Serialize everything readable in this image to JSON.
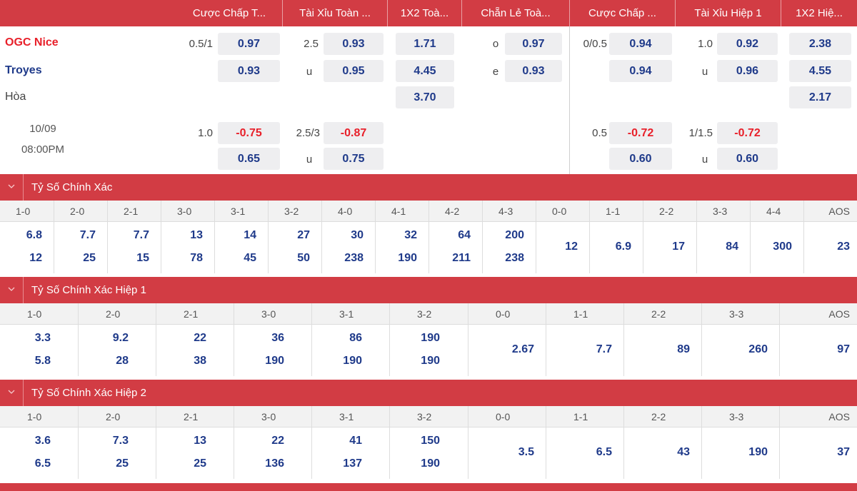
{
  "header": {
    "columns": [
      "Cược Chấp T...",
      "Tài Xỉu Toàn ...",
      "1X2 Toà...",
      "Chẵn Lẻ Toà...",
      "Cược Chấp ...",
      "Tài Xỉu Hiệp 1",
      "1X2 Hiệ..."
    ]
  },
  "match": {
    "home_team": "OGC Nice",
    "away_team": "Troyes",
    "draw_label": "Hòa",
    "date": "10/09",
    "time": "08:00PM"
  },
  "odds": {
    "ft_handicap": {
      "line": "0.5/1",
      "home": "0.97",
      "away": "0.93"
    },
    "ft_total": {
      "line": "2.5",
      "over": "0.93",
      "under_label": "u",
      "under": "0.95"
    },
    "ft_1x2": {
      "home": "1.71",
      "away": "4.45",
      "draw": "3.70"
    },
    "ft_odd_even": {
      "odd_label": "o",
      "odd": "0.97",
      "even_label": "e",
      "even": "0.93"
    },
    "h1_handicap": {
      "line": "0/0.5",
      "home": "0.94",
      "away": "0.94"
    },
    "h1_total": {
      "line": "1.0",
      "over": "0.92",
      "under_label": "u",
      "under": "0.96"
    },
    "h1_1x2": {
      "home": "2.38",
      "away": "4.55",
      "draw": "2.17"
    },
    "alt": {
      "ft_handicap": {
        "line": "1.0",
        "home": "-0.75",
        "away": "0.65"
      },
      "ft_total": {
        "line": "2.5/3",
        "over": "-0.87",
        "under_label": "u",
        "under": "0.75"
      },
      "h1_handicap": {
        "line": "0.5",
        "home": "-0.72",
        "away": "0.60"
      },
      "h1_total": {
        "line": "1/1.5",
        "over": "-0.72",
        "under_label": "u",
        "under": "0.60"
      }
    }
  },
  "sections": [
    {
      "title": "Tỷ Số Chính Xác",
      "scores": [
        {
          "label": "1-0",
          "home": "6.8",
          "away": "12"
        },
        {
          "label": "2-0",
          "home": "7.7",
          "away": "25"
        },
        {
          "label": "2-1",
          "home": "7.7",
          "away": "15"
        },
        {
          "label": "3-0",
          "home": "13",
          "away": "78"
        },
        {
          "label": "3-1",
          "home": "14",
          "away": "45"
        },
        {
          "label": "3-2",
          "home": "27",
          "away": "50"
        },
        {
          "label": "4-0",
          "home": "30",
          "away": "238"
        },
        {
          "label": "4-1",
          "home": "32",
          "away": "190"
        },
        {
          "label": "4-2",
          "home": "64",
          "away": "211"
        },
        {
          "label": "4-3",
          "home": "200",
          "away": "238"
        },
        {
          "label": "0-0",
          "single": "12"
        },
        {
          "label": "1-1",
          "single": "6.9"
        },
        {
          "label": "2-2",
          "single": "17"
        },
        {
          "label": "3-3",
          "single": "84"
        },
        {
          "label": "4-4",
          "single": "300"
        },
        {
          "label": "AOS",
          "single": "23"
        }
      ]
    },
    {
      "title": "Tỷ Số Chính Xác Hiệp 1",
      "scores": [
        {
          "label": "1-0",
          "home": "3.3",
          "away": "5.8"
        },
        {
          "label": "2-0",
          "home": "9.2",
          "away": "28"
        },
        {
          "label": "2-1",
          "home": "22",
          "away": "38"
        },
        {
          "label": "3-0",
          "home": "36",
          "away": "190"
        },
        {
          "label": "3-1",
          "home": "86",
          "away": "190"
        },
        {
          "label": "3-2",
          "home": "190",
          "away": "190"
        },
        {
          "label": "0-0",
          "single": "2.67"
        },
        {
          "label": "1-1",
          "single": "7.7"
        },
        {
          "label": "2-2",
          "single": "89"
        },
        {
          "label": "3-3",
          "single": "260"
        },
        {
          "label": "AOS",
          "single": "97"
        }
      ]
    },
    {
      "title": "Tỷ Số Chính Xác Hiệp 2",
      "scores": [
        {
          "label": "1-0",
          "home": "3.6",
          "away": "6.5"
        },
        {
          "label": "2-0",
          "home": "7.3",
          "away": "25"
        },
        {
          "label": "2-1",
          "home": "13",
          "away": "25"
        },
        {
          "label": "3-0",
          "home": "22",
          "away": "136"
        },
        {
          "label": "3-1",
          "home": "41",
          "away": "137"
        },
        {
          "label": "3-2",
          "home": "150",
          "away": "190"
        },
        {
          "label": "0-0",
          "single": "3.5"
        },
        {
          "label": "1-1",
          "single": "6.5"
        },
        {
          "label": "2-2",
          "single": "43"
        },
        {
          "label": "3-3",
          "single": "190"
        },
        {
          "label": "AOS",
          "single": "37"
        }
      ]
    }
  ]
}
